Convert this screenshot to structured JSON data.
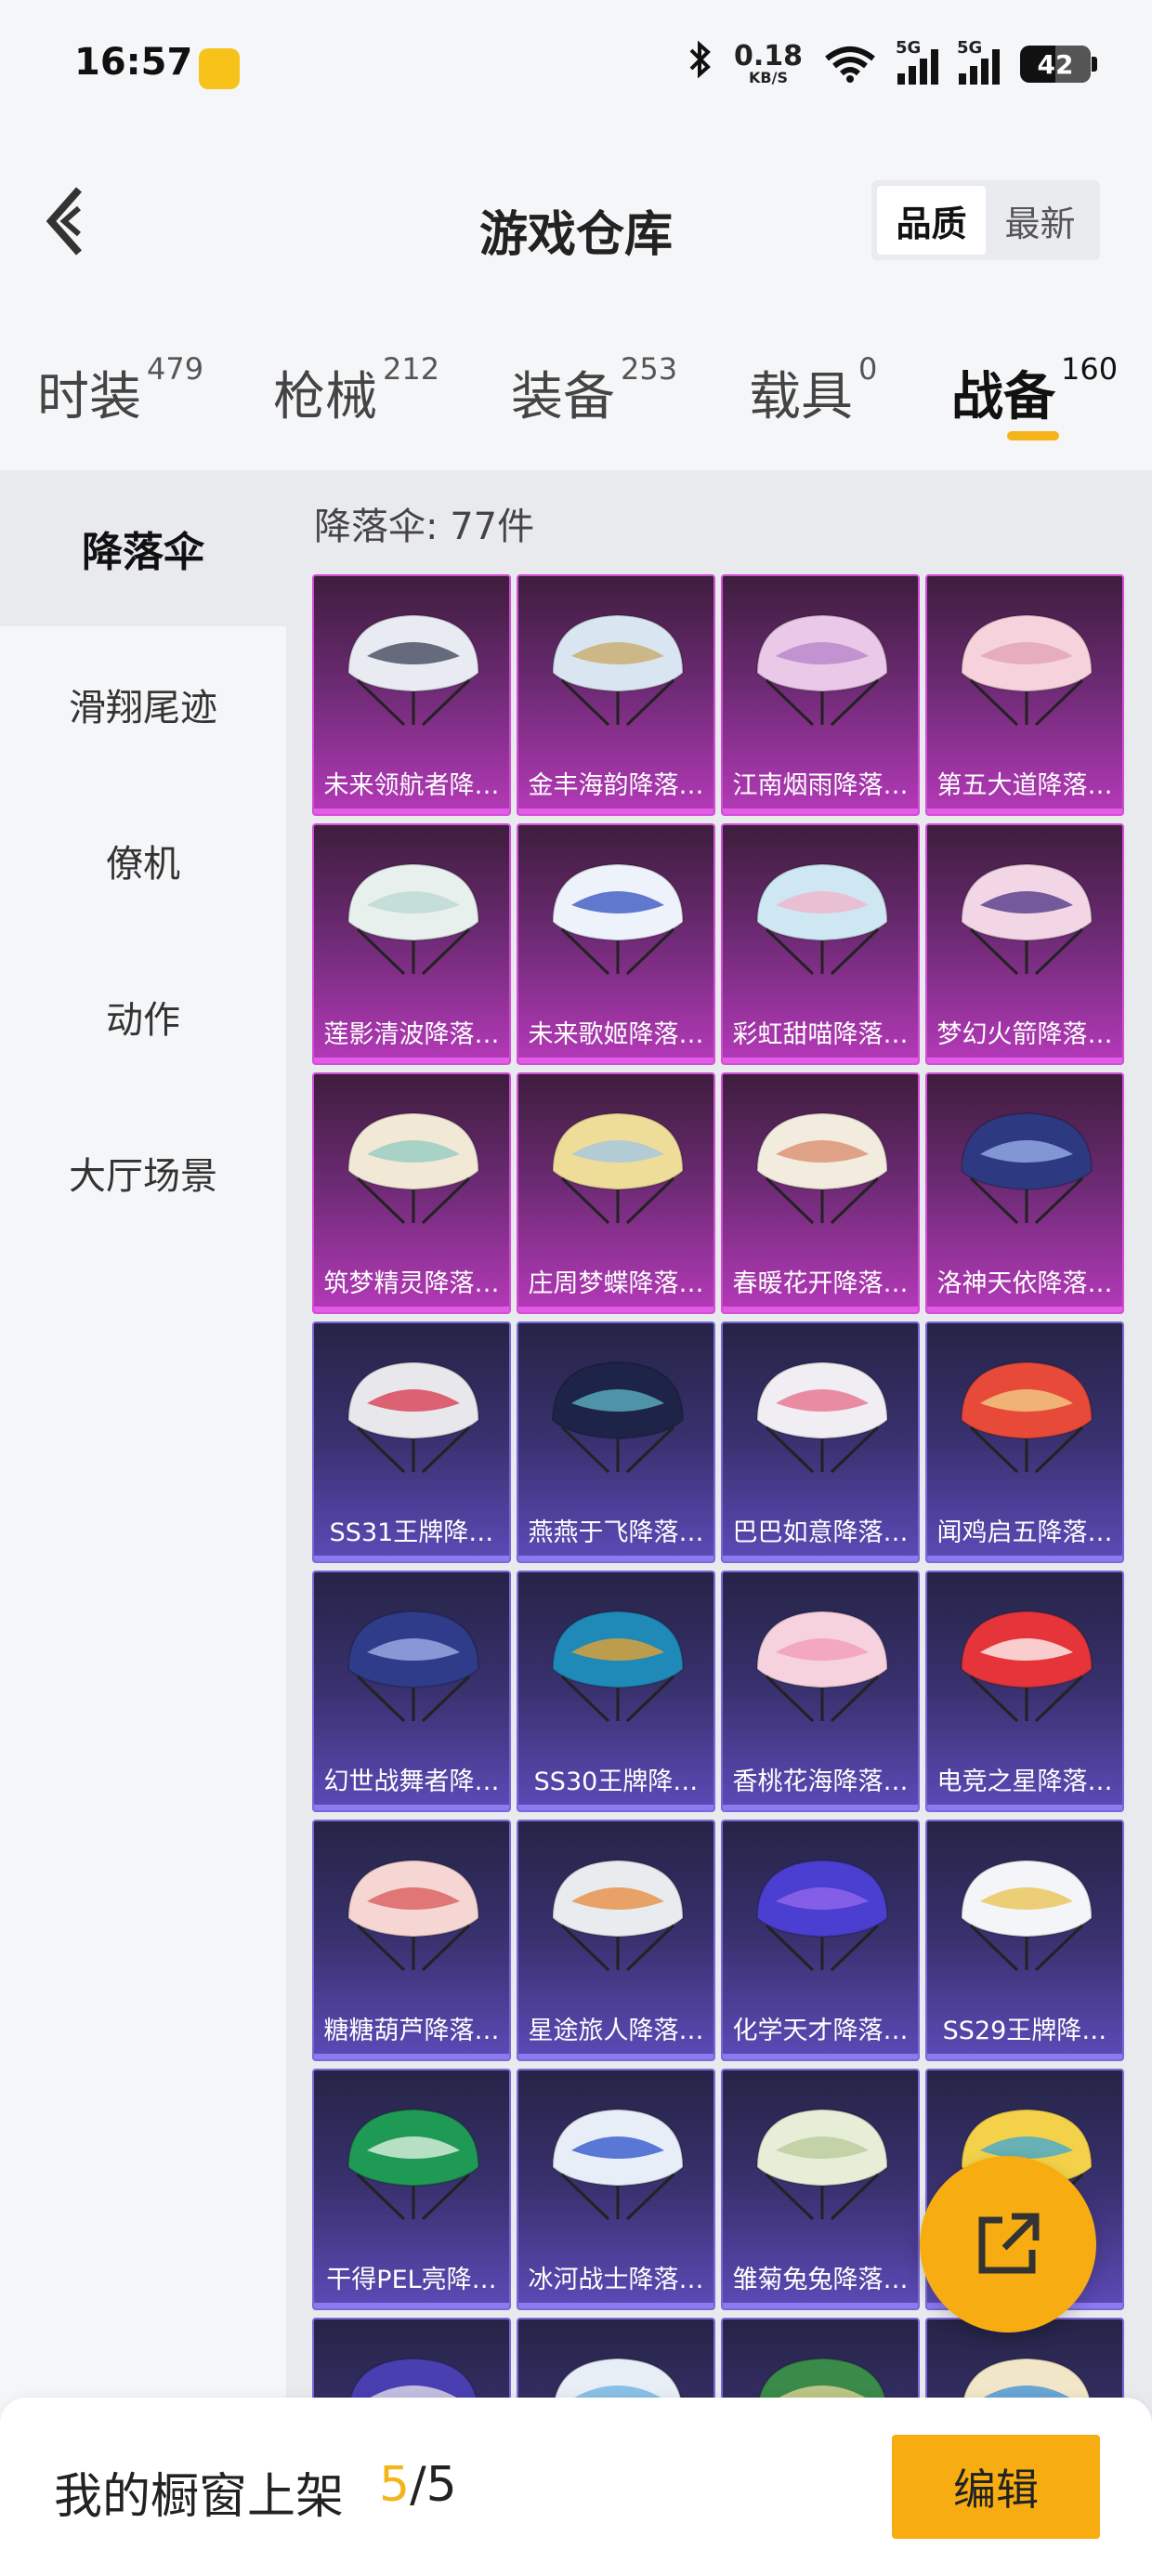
{
  "status_bar": {
    "time": "16:57",
    "speed_value": "0.18",
    "speed_unit": "KB/S",
    "signal1_label": "5G",
    "signal2_label": "5G",
    "battery": "42",
    "icons": [
      "app-icon",
      "bluetooth-icon",
      "wifi-icon",
      "signal-icon",
      "battery-icon"
    ]
  },
  "header": {
    "title": "游戏仓库",
    "sort_options": [
      "品质",
      "最新"
    ],
    "sort_active": "品质"
  },
  "category_tabs": [
    {
      "label": "时装",
      "count": "479"
    },
    {
      "label": "枪械",
      "count": "212"
    },
    {
      "label": "装备",
      "count": "253"
    },
    {
      "label": "载具",
      "count": "0"
    },
    {
      "label": "战备",
      "count": "160"
    }
  ],
  "active_category": "战备",
  "sidebar": {
    "items": [
      "降落伞",
      "滑翔尾迹",
      "僚机",
      "动作",
      "大厅场景"
    ],
    "active": "降落伞"
  },
  "content": {
    "title": "降落伞: 77件",
    "items": [
      {
        "label": "未来领航者降…",
        "rarity": "purple",
        "color": "#e8ecf2",
        "accent": "#3a3f55"
      },
      {
        "label": "金丰海韵降落…",
        "rarity": "purple",
        "color": "#d9e6f2",
        "accent": "#c7a862"
      },
      {
        "label": "江南烟雨降落…",
        "rarity": "purple",
        "color": "#e9c8e8",
        "accent": "#b680c8"
      },
      {
        "label": "第五大道降落…",
        "rarity": "purple",
        "color": "#f6d3dc",
        "accent": "#e0a0b5"
      },
      {
        "label": "莲影清波降落…",
        "rarity": "purple",
        "color": "#e8f0ee",
        "accent": "#b9d8cf"
      },
      {
        "label": "未来歌姬降落…",
        "rarity": "purple",
        "color": "#eef3fb",
        "accent": "#3050c0"
      },
      {
        "label": "彩虹甜喵降落…",
        "rarity": "purple",
        "color": "#cfe6f3",
        "accent": "#f2b3c8"
      },
      {
        "label": "梦幻火箭降落…",
        "rarity": "purple",
        "color": "#f3d6e6",
        "accent": "#4a3080"
      },
      {
        "label": "筑梦精灵降落…",
        "rarity": "purple",
        "color": "#f1e9d6",
        "accent": "#8fc9c0"
      },
      {
        "label": "庄周梦蝶降落…",
        "rarity": "purple",
        "color": "#eedd98",
        "accent": "#9fc6e8"
      },
      {
        "label": "春暖花开降落…",
        "rarity": "purple",
        "color": "#f2ecde",
        "accent": "#d98a6a"
      },
      {
        "label": "洛神天依降落…",
        "rarity": "purple",
        "color": "#2d3a82",
        "accent": "#9fb6f0"
      },
      {
        "label": "SS31王牌降…",
        "rarity": "blue",
        "color": "#e8e8ec",
        "accent": "#d8344a"
      },
      {
        "label": "燕燕于飞降落…",
        "rarity": "blue",
        "color": "#1d2447",
        "accent": "#5fb8c8"
      },
      {
        "label": "巴巴如意降落…",
        "rarity": "blue",
        "color": "#f0eef2",
        "accent": "#e86a8a"
      },
      {
        "label": "闻鸡启五降落…",
        "rarity": "blue",
        "color": "#e84a3a",
        "accent": "#f3d58a"
      },
      {
        "label": "幻世战舞者降…",
        "rarity": "blue",
        "color": "#2f3c8a",
        "accent": "#a8b6ef"
      },
      {
        "label": "SS30王牌降…",
        "rarity": "blue",
        "color": "#1f8ab8",
        "accent": "#f2a32a"
      },
      {
        "label": "香桃花海降落…",
        "rarity": "blue",
        "color": "#f6d1de",
        "accent": "#f19ab6"
      },
      {
        "label": "电竞之星降落…",
        "rarity": "blue",
        "color": "#e5353b",
        "accent": "#ffffff"
      },
      {
        "label": "糖糖葫芦降落…",
        "rarity": "blue",
        "color": "#f6d6d2",
        "accent": "#d85656"
      },
      {
        "label": "星途旅人降落…",
        "rarity": "blue",
        "color": "#e9ecef",
        "accent": "#e78a3a"
      },
      {
        "label": "化学天才降落…",
        "rarity": "blue",
        "color": "#4a3fd0",
        "accent": "#9a6af0"
      },
      {
        "label": "SS29王牌降…",
        "rarity": "blue",
        "color": "#f3f5f8",
        "accent": "#e9c04c"
      },
      {
        "label": "干得PEL亮降…",
        "rarity": "blue",
        "color": "#1f9a55",
        "accent": "#e9f5ea"
      },
      {
        "label": "冰河战士降落…",
        "rarity": "blue",
        "color": "#e8eef8",
        "accent": "#2a4fc8"
      },
      {
        "label": "雏菊兔兔降落…",
        "rarity": "blue",
        "color": "#e6eed8",
        "accent": "#b8c898"
      },
      {
        "label": "",
        "rarity": "blue",
        "color": "#f3d24a",
        "accent": "#3aa6d8"
      },
      {
        "label": "",
        "rarity": "blue",
        "color": "#4a3fb0",
        "accent": "#e8e8f0"
      },
      {
        "label": "",
        "rarity": "blue",
        "color": "#e8eef6",
        "accent": "#6ab0e0"
      },
      {
        "label": "",
        "rarity": "blue",
        "color": "#3a8a4a",
        "accent": "#e8d89a"
      },
      {
        "label": "",
        "rarity": "blue",
        "color": "#f2e6c8",
        "accent": "#3a90d8"
      }
    ]
  },
  "fab": {
    "icon": "share-external-icon"
  },
  "bottom_bar": {
    "label": "我的橱窗上架",
    "current": "5",
    "separator": "/",
    "total": "5",
    "edit_label": "编辑"
  },
  "colors": {
    "accent": "#f5b51a",
    "purple_rarity": "#b539b9",
    "blue_rarity": "#5d4ab8"
  }
}
